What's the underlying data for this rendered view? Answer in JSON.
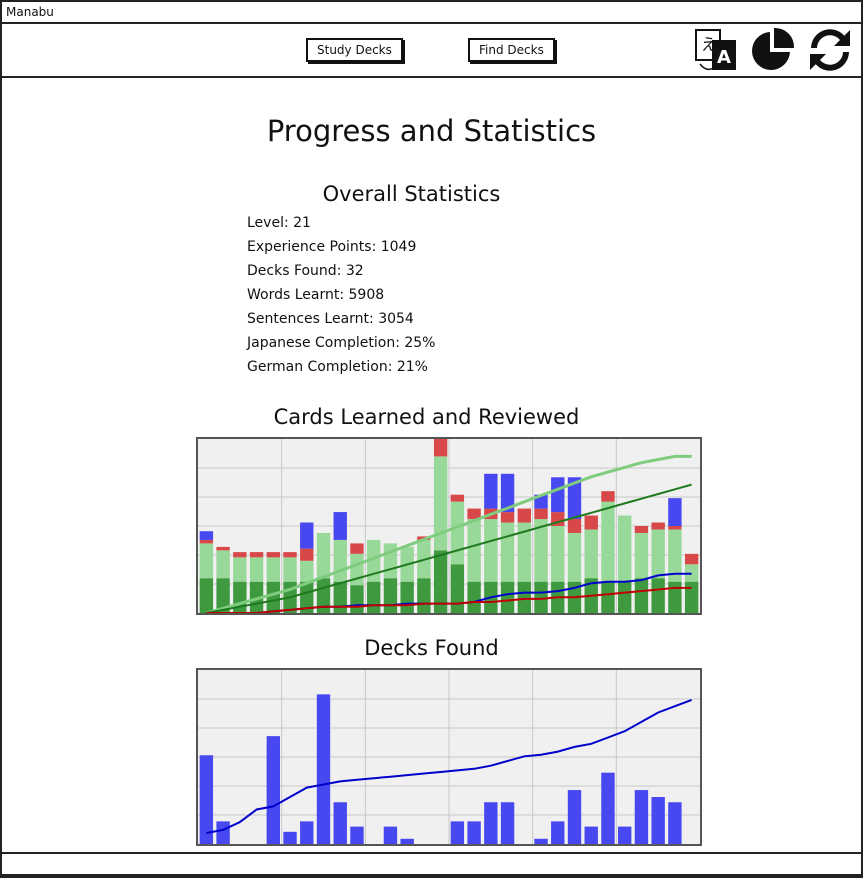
{
  "window": {
    "title": "Manabu"
  },
  "toolbar": {
    "study_decks": "Study Decks",
    "find_decks": "Find Decks",
    "icons": [
      "translate-icon",
      "pie-chart-icon",
      "sync-icon"
    ]
  },
  "page": {
    "title": "Progress and Statistics",
    "overall_title": "Overall Statistics",
    "stats": [
      "Level: 21",
      "Experience Points: 1049",
      "Decks Found: 32",
      "Words Learnt: 5908",
      "Sentences Learnt: 3054",
      "Japanese Completion: 25%",
      "German Completion: 21%"
    ],
    "cards_title": "Cards Learned and Reviewed",
    "decks_title": "Decks Found"
  },
  "colors": {
    "dark_green": "#3f9a3f",
    "light_green": "#98d898",
    "red": "#d94848",
    "blue": "#4848f0",
    "line_blue": "#0000cc",
    "line_red": "#c00000",
    "line_green": "#1f7a1f",
    "line_light_green": "#7fcc7f"
  },
  "chart_data": [
    {
      "type": "bar",
      "bars_unit_max": 100,
      "stacked_series": {
        "dark_green": [
          20,
          20,
          18,
          18,
          18,
          18,
          18,
          20,
          18,
          16,
          18,
          20,
          18,
          20,
          36,
          28,
          18,
          18,
          18,
          18,
          18,
          18,
          18,
          20,
          18,
          18,
          20,
          20,
          18,
          18
        ],
        "light_green": [
          20,
          16,
          14,
          14,
          14,
          14,
          12,
          26,
          24,
          18,
          24,
          20,
          20,
          22,
          54,
          36,
          36,
          36,
          34,
          34,
          36,
          32,
          28,
          28,
          46,
          38,
          26,
          28,
          30,
          10
        ],
        "red": [
          2,
          2,
          3,
          3,
          3,
          3,
          7,
          0,
          0,
          6,
          0,
          0,
          0,
          2,
          13,
          4,
          6,
          6,
          6,
          8,
          6,
          8,
          8,
          8,
          6,
          0,
          4,
          4,
          2,
          6
        ],
        "blue": [
          5,
          0,
          0,
          0,
          0,
          0,
          15,
          0,
          16,
          0,
          0,
          0,
          0,
          0,
          0,
          0,
          0,
          20,
          22,
          0,
          8,
          20,
          24,
          0,
          0,
          0,
          0,
          0,
          16,
          0
        ]
      },
      "lines": {
        "blue": [
          0,
          0,
          0,
          0,
          1,
          2,
          3,
          4,
          4,
          5,
          5,
          5,
          6,
          6,
          6,
          6,
          7,
          10,
          12,
          13,
          13,
          14,
          16,
          19,
          20,
          20,
          21,
          24,
          25,
          25
        ],
        "red": [
          0,
          0,
          0,
          0,
          1,
          2,
          3,
          4,
          4,
          4,
          5,
          5,
          5,
          6,
          6,
          6,
          7,
          7,
          8,
          9,
          9,
          10,
          10,
          11,
          12,
          13,
          14,
          15,
          16,
          16
        ],
        "green": [
          0,
          2,
          4,
          6,
          8,
          10,
          13,
          16,
          19,
          22,
          25,
          28,
          31,
          34,
          37,
          40,
          43,
          46,
          49,
          52,
          55,
          58,
          61,
          64,
          67,
          70,
          73,
          76,
          79,
          82
        ],
        "light_green": [
          0,
          3,
          6,
          9,
          12,
          15,
          19,
          23,
          27,
          31,
          35,
          39,
          43,
          47,
          51,
          55,
          59,
          63,
          67,
          71,
          75,
          79,
          83,
          87,
          90,
          93,
          96,
          98,
          100,
          100
        ]
      }
    },
    {
      "type": "bar",
      "bars_unit_max": 100,
      "values": [
        51,
        13,
        0,
        0,
        62,
        7,
        13,
        86,
        24,
        10,
        0,
        10,
        3,
        0,
        0,
        13,
        13,
        24,
        24,
        0,
        3,
        13,
        31,
        10,
        41,
        10,
        31,
        27,
        24,
        0
      ],
      "line": [
        7,
        9,
        14,
        22,
        24,
        30,
        36,
        38,
        40,
        41,
        42,
        43,
        44,
        45,
        46,
        47,
        48,
        50,
        53,
        56,
        57,
        59,
        62,
        64,
        68,
        72,
        78,
        84,
        88,
        92
      ]
    }
  ]
}
